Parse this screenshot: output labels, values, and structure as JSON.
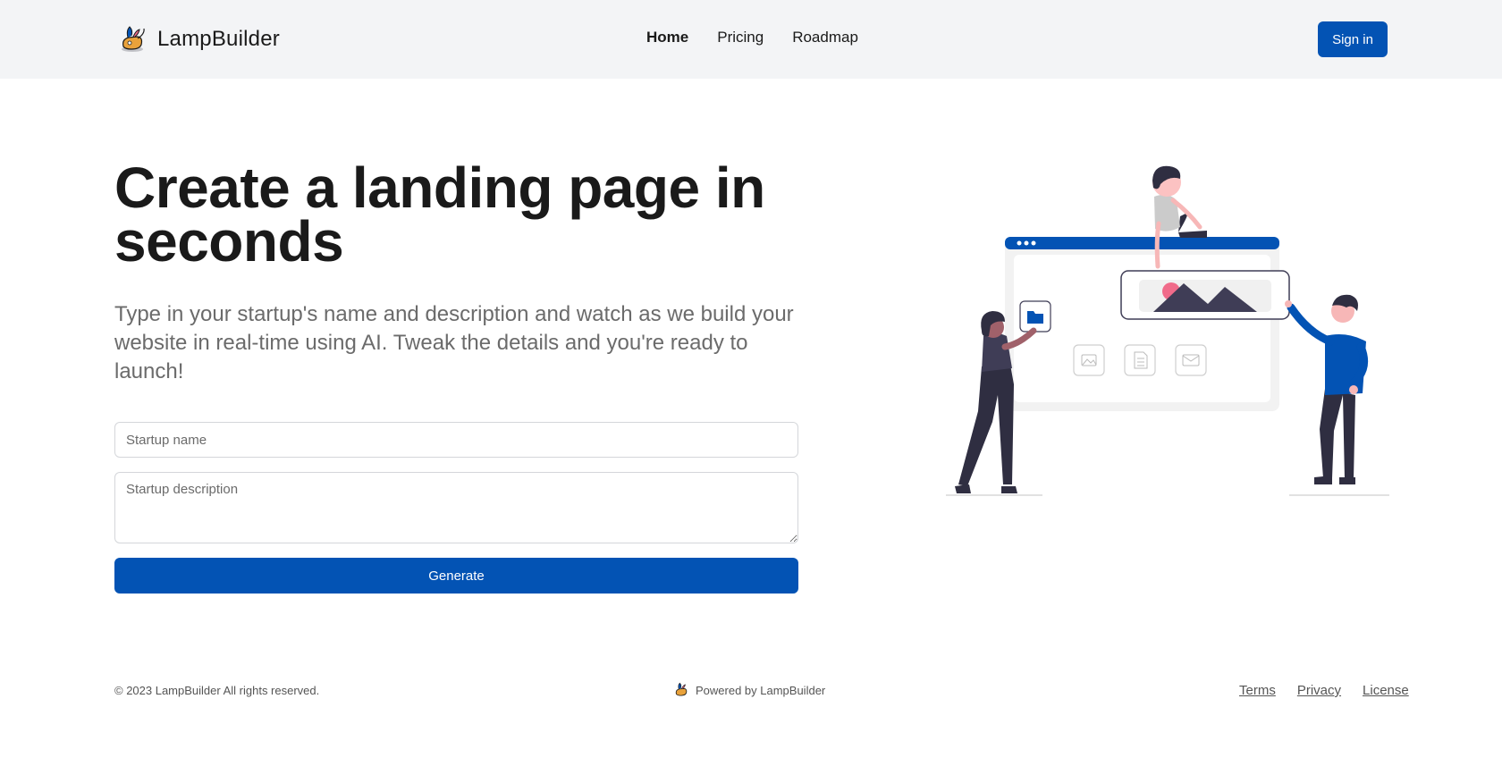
{
  "header": {
    "brand_name": "LampBuilder",
    "nav": [
      {
        "label": "Home",
        "active": true
      },
      {
        "label": "Pricing",
        "active": false
      },
      {
        "label": "Roadmap",
        "active": false
      }
    ],
    "sign_in_label": "Sign in"
  },
  "hero": {
    "title": "Create a landing page in seconds",
    "subtitle": "Type in your startup's name and description and watch as we build your website in real-time using AI. Tweak the details and you're ready to launch!"
  },
  "form": {
    "name_placeholder": "Startup name",
    "description_placeholder": "Startup description",
    "generate_label": "Generate"
  },
  "footer": {
    "copyright": "© 2023 LampBuilder All rights reserved.",
    "powered_by": "Powered by LampBuilder",
    "links": [
      "Terms",
      "Privacy",
      "License"
    ]
  },
  "colors": {
    "primary": "#0353b4",
    "header_bg": "#f3f4f6",
    "text": "#1a1a1a",
    "muted": "#6b6b6b",
    "accent_pink": "#f06b8a",
    "figure_dark": "#2f2e41"
  },
  "icons": [
    "lamp-logo-icon",
    "folder-icon",
    "image-icon",
    "document-icon",
    "mail-icon"
  ]
}
